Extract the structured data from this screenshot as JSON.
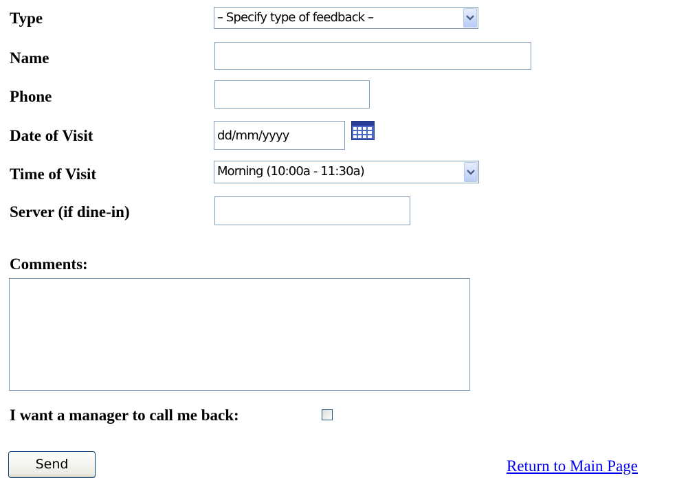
{
  "form": {
    "type": {
      "label": "Type",
      "selected": "– Specify type of feedback –"
    },
    "name": {
      "label": "Name",
      "value": ""
    },
    "phone": {
      "label": "Phone",
      "value": ""
    },
    "date_of_visit": {
      "label": "Date of Visit",
      "value": "dd/mm/yyyy",
      "icon": "calendar-icon"
    },
    "time_of_visit": {
      "label": "Time of Visit",
      "selected": "Morning (10:00a - 11:30a)"
    },
    "server": {
      "label": "Server (if dine-in)",
      "value": ""
    },
    "comments": {
      "label": "Comments:",
      "value": ""
    },
    "callback": {
      "label": "I want a manager to call me back:",
      "checked": false
    },
    "send_label": "Send",
    "return_link": "Return to Main Page"
  },
  "colors": {
    "field_border": "#7f9db9",
    "link": "#0000ee",
    "dropdown_arrow": "#4d6185"
  }
}
